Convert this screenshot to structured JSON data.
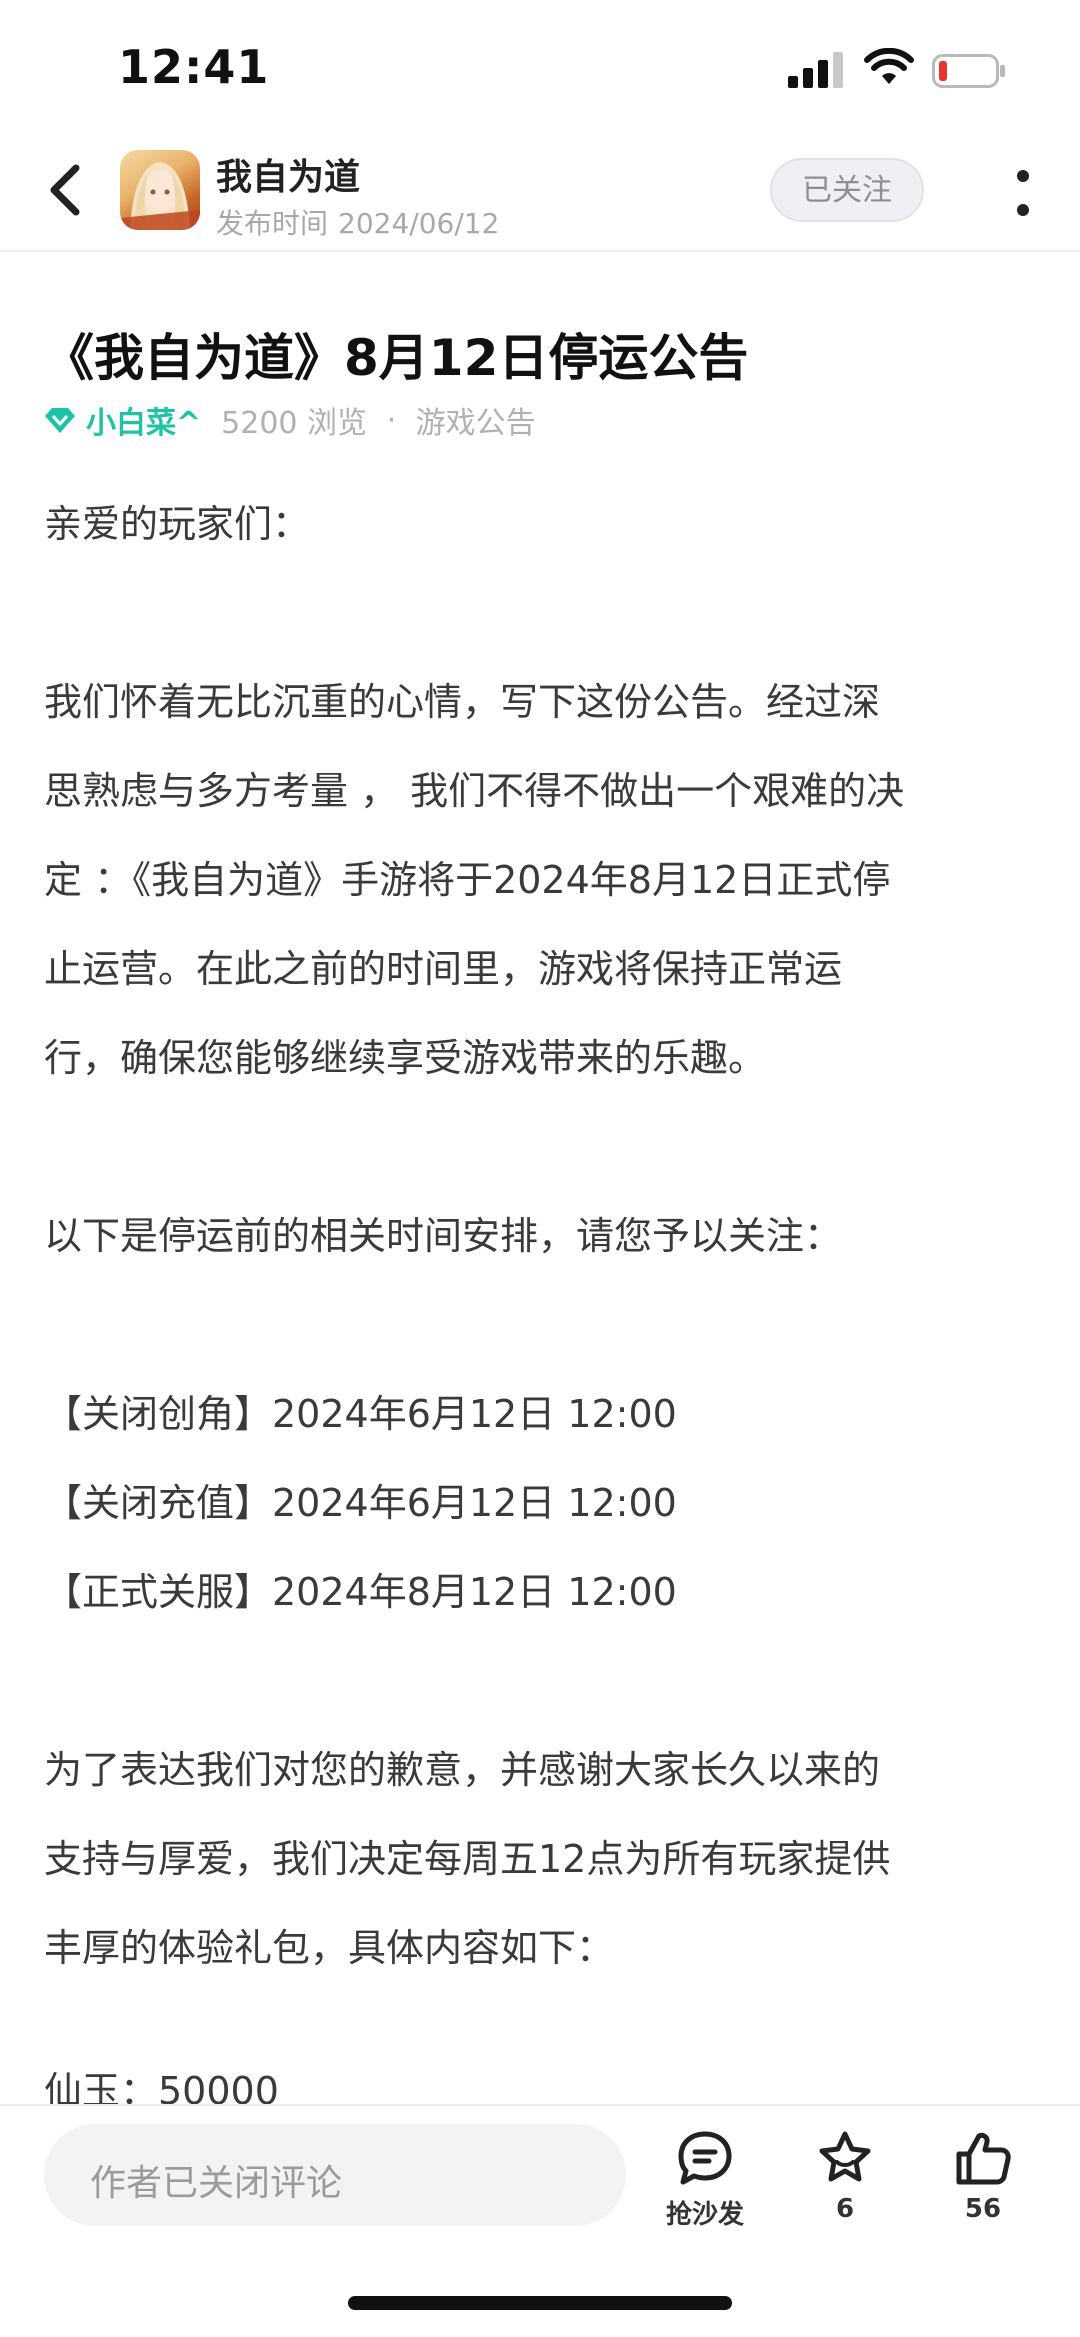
{
  "status_bar": {
    "time": "12:41"
  },
  "header": {
    "game_name": "我自为道",
    "publish_label": "发布时间",
    "publish_date": "2024/06/12",
    "follow_label": "已关注"
  },
  "article": {
    "title": "《我自为道》8月12日停运公告",
    "author": "小白菜^",
    "views": "5200 浏览",
    "separator": "·",
    "category": "游戏公告",
    "lines": [
      "亲爱的玩家们：",
      "",
      "我们怀着无比沉重的心情，写下这份公告。经过深",
      "思熟虑与多方考量 ， 我们不得不做出一个艰难的决",
      "定 ：《我自为道》手游将于2024年8月12日正式停",
      "止运营。在此之前的时间里，游戏将保持正常运",
      "行，确保您能够继续享受游戏带来的乐趣。",
      "",
      "以下是停运前的相关时间安排，请您予以关注：",
      "",
      "【关闭创角】2024年6月12日 12:00",
      "【关闭充值】2024年6月12日 12:00",
      "【正式关服】2024年8月12日 12:00",
      "",
      "为了表达我们对您的歉意，并感谢大家长久以来的",
      "支持与厚爱，我们决定每周五12点为所有玩家提供",
      "丰厚的体验礼包，具体内容如下："
    ],
    "clipped_line": "仙玉：50000"
  },
  "bottom_bar": {
    "comment_placeholder": "作者已关闭评论",
    "sofa_label": "抢沙发",
    "favorite_count": "6",
    "like_count": "56"
  },
  "colors": {
    "accent_green": "#1ec2a4",
    "battery_low": "#e8342f"
  }
}
